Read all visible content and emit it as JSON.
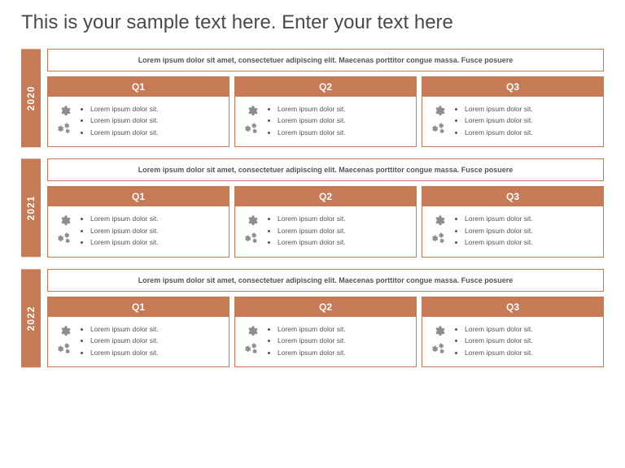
{
  "title": "This is your sample text here. Enter your text here",
  "accent": "#c77a56",
  "years": [
    {
      "label": "2020",
      "summary": "Lorem ipsum dolor sit amet, consectetuer adipiscing elit. Maecenas porttitor congue massa. Fusce posuere",
      "quarters": [
        {
          "label": "Q1",
          "bullets": [
            "Lorem ipsum dolor sit.",
            "Lorem ipsum dolor sit.",
            "Lorem ipsum dolor sit."
          ]
        },
        {
          "label": "Q2",
          "bullets": [
            "Lorem ipsum dolor sit.",
            "Lorem ipsum dolor sit.",
            "Lorem ipsum dolor sit."
          ]
        },
        {
          "label": "Q3",
          "bullets": [
            "Lorem ipsum dolor sit.",
            "Lorem ipsum dolor sit.",
            "Lorem ipsum dolor sit."
          ]
        }
      ]
    },
    {
      "label": "2021",
      "summary": "Lorem ipsum dolor sit amet, consectetuer adipiscing elit. Maecenas porttitor congue massa. Fusce posuere",
      "quarters": [
        {
          "label": "Q1",
          "bullets": [
            "Lorem ipsum dolor sit.",
            "Lorem ipsum dolor sit.",
            "Lorem ipsum dolor sit."
          ]
        },
        {
          "label": "Q2",
          "bullets": [
            "Lorem ipsum dolor sit.",
            "Lorem ipsum dolor sit.",
            "Lorem ipsum dolor sit."
          ]
        },
        {
          "label": "Q3",
          "bullets": [
            "Lorem ipsum dolor sit.",
            "Lorem ipsum dolor sit.",
            "Lorem ipsum dolor sit."
          ]
        }
      ]
    },
    {
      "label": "2022",
      "summary": "Lorem ipsum dolor sit amet, consectetuer adipiscing elit. Maecenas porttitor congue massa. Fusce posuere",
      "quarters": [
        {
          "label": "Q1",
          "bullets": [
            "Lorem ipsum dolor sit.",
            "Lorem ipsum dolor sit.",
            "Lorem ipsum dolor sit."
          ]
        },
        {
          "label": "Q2",
          "bullets": [
            "Lorem ipsum dolor sit.",
            "Lorem ipsum dolor sit.",
            "Lorem ipsum dolor sit."
          ]
        },
        {
          "label": "Q3",
          "bullets": [
            "Lorem ipsum dolor sit.",
            "Lorem ipsum dolor sit.",
            "Lorem ipsum dolor sit."
          ]
        }
      ]
    }
  ]
}
